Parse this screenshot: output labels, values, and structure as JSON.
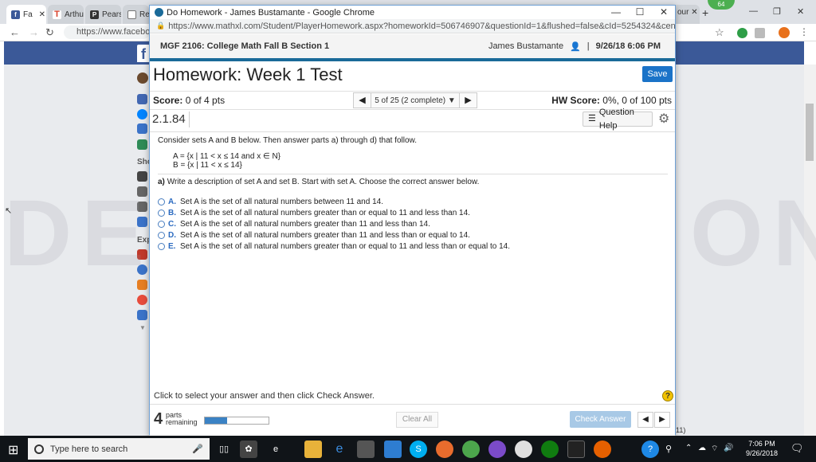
{
  "bg_browser": {
    "tabs": [
      {
        "label": "Fa",
        "icon": "facebook-icon",
        "color": "#3b5998"
      },
      {
        "label": "Arthu",
        "icon": "t-icon",
        "color": "#d9422c"
      },
      {
        "label": "Pears",
        "icon": "pearson-icon",
        "color": "#333333"
      },
      {
        "label": "Re",
        "icon": "doc-icon",
        "color": "#555555"
      }
    ],
    "right_tab": "our",
    "url": "https://www.facebook",
    "ext_badge": "64",
    "below_popup_text": "11)"
  },
  "popup": {
    "window_title": "Do Homework - James Bustamante - Google Chrome",
    "url": "https://www.mathxl.com/Student/PlayerHomework.aspx?homeworkId=506746907&questionId=1&flushed=false&cId=5254324&centerwin=yes",
    "course_title": "MGF 2106: College Math Fall B Section 1",
    "user_name": "James Bustamante",
    "separator": "|",
    "datetime": "9/26/18 6:06 PM",
    "hw_title": "Homework: Week 1 Test",
    "save_label": "Save",
    "score_label": "Score:",
    "score_value": "0 of 4 pts",
    "nav_text": "5 of 25 (2 complete)",
    "hw_score_label": "HW Score:",
    "hw_score_value": "0%, 0 of 100 pts",
    "question_number": "2.1.84",
    "question_help_label": "Question Help",
    "intro": "Consider sets A and B below. Then answer parts a) through d) that follow.",
    "set_a": "A = {x | 11 < x ≤ 14 and x ∈ N}",
    "set_b": "B = {x | 11 < x ≤ 14}",
    "part_a_label": "a)",
    "part_a_text": "Write a description of set A and set B. Start with set A. Choose the correct answer below.",
    "options": [
      {
        "letter": "A.",
        "text": "Set A is the set of all natural numbers between 11 and 14."
      },
      {
        "letter": "B.",
        "text": "Set A is the set of all natural numbers greater than or equal to 11 and less than 14."
      },
      {
        "letter": "C.",
        "text": "Set A is the set of all natural numbers greater than 11 and less than 14."
      },
      {
        "letter": "D.",
        "text": "Set A is the set of all natural numbers greater than 11 and less than or equal to 14."
      },
      {
        "letter": "E.",
        "text": "Set A is the set of all natural numbers greater than or equal to 11 and less than or equal to 14."
      }
    ],
    "footer_hint": "Click to select your answer and then click Check Answer.",
    "parts_remaining_num": "4",
    "parts_remaining_line1": "parts",
    "parts_remaining_line2": "remaining",
    "parts_progress": 0.35,
    "clear_all_label": "Clear All",
    "check_answer_label": "Check Answer"
  },
  "watermark": "DEMO VERSION",
  "side_labels": {
    "sho": "Sho",
    "exp": "Exp"
  },
  "taskbar": {
    "search_placeholder": "Type here to search",
    "time": "7:06 PM",
    "date": "9/26/2018"
  },
  "colors": {
    "facebook_blue": "#3b5998",
    "mathxl_accent": "#1a6a99",
    "save_button": "#1a73c8",
    "option_letter": "#2a6ac0"
  }
}
